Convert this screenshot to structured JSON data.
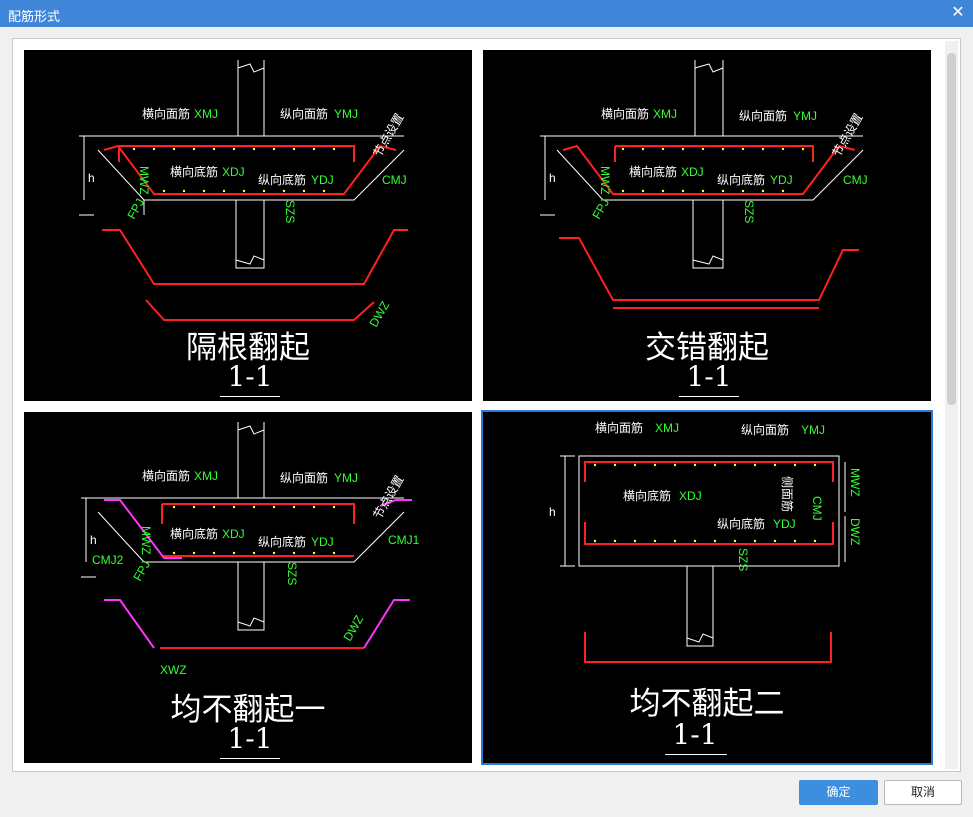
{
  "window": {
    "title": "配筋形式",
    "close_glyph": "✕"
  },
  "options": [
    {
      "caption": "隔根翻起",
      "section": "1-1",
      "labels": {
        "top_transverse": "横向面筋",
        "top_transverse_code": "XMJ",
        "top_longitudinal": "纵向面筋",
        "top_longitudinal_code": "YMJ",
        "bottom_transverse": "横向底筋",
        "bottom_transverse_code": "XDJ",
        "bottom_longitudinal": "纵向底筋",
        "bottom_longitudinal_code": "YDJ",
        "node_setting": "节点设置",
        "h": "h",
        "mwz": "MWZ",
        "cmj": "CMJ",
        "fpj": "FPJ",
        "szs": "SZS",
        "dwz": "DWZ"
      }
    },
    {
      "caption": "交错翻起",
      "section": "1-1",
      "labels": {
        "top_transverse": "横向面筋",
        "top_transverse_code": "XMJ",
        "top_longitudinal": "纵向面筋",
        "top_longitudinal_code": "YMJ",
        "bottom_transverse": "横向底筋",
        "bottom_transverse_code": "XDJ",
        "bottom_longitudinal": "纵向底筋",
        "bottom_longitudinal_code": "YDJ",
        "node_setting": "节点设置",
        "h": "h",
        "mwz": "MWZ",
        "cmj": "CMJ",
        "fpj": "FPJ",
        "szs": "SZS"
      }
    },
    {
      "caption": "均不翻起一",
      "section": "1-1",
      "labels": {
        "top_transverse": "横向面筋",
        "top_transverse_code": "XMJ",
        "top_longitudinal": "纵向面筋",
        "top_longitudinal_code": "YMJ",
        "bottom_transverse": "横向底筋",
        "bottom_transverse_code": "XDJ",
        "bottom_longitudinal": "纵向底筋",
        "bottom_longitudinal_code": "YDJ",
        "node_setting": "节点设置",
        "h": "h",
        "mwz": "MWZ",
        "cmj1": "CMJ1",
        "cmj2": "CMJ2",
        "fpj": "FPJ",
        "szs": "SZS",
        "dwz": "DWZ",
        "xwz": "XWZ"
      }
    },
    {
      "caption": "均不翻起二",
      "section": "1-1",
      "selected": true,
      "labels": {
        "top_transverse": "横向面筋",
        "top_transverse_code": "XMJ",
        "top_longitudinal": "纵向面筋",
        "top_longitudinal_code": "YMJ",
        "bottom_transverse": "横向底筋",
        "bottom_transverse_code": "XDJ",
        "bottom_longitudinal": "纵向底筋",
        "bottom_longitudinal_code": "YDJ",
        "side_face": "侧面筋",
        "h": "h",
        "mwz": "MWZ",
        "cmj": "CMJ",
        "szs": "SZS",
        "dwz": "DWZ"
      }
    }
  ],
  "buttons": {
    "ok": "确定",
    "cancel": "取消"
  },
  "colors": {
    "titlebar": "#3f86d8",
    "rebar": "#ff2020",
    "rebar_alt": "#ff33ff",
    "code_text": "#33ff33",
    "selected_border": "#2b7bd6",
    "ok_button": "#3e8ee0"
  }
}
